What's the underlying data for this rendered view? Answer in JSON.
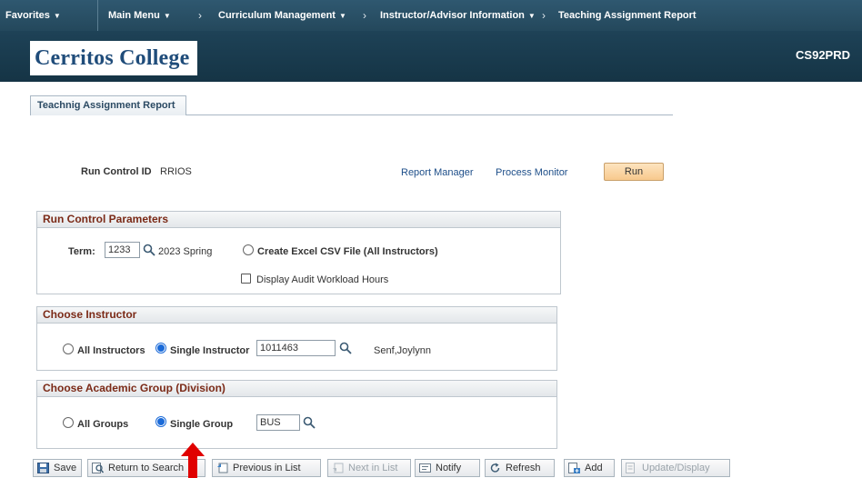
{
  "nav": {
    "favorites": "Favorites",
    "main_menu": "Main Menu",
    "crumbs": [
      "Curriculum Management",
      "Instructor/Advisor Information",
      "Teaching Assignment Report"
    ]
  },
  "header": {
    "logo": "Cerritos College",
    "database": "CS92PRD"
  },
  "page_tab": "Teachnig Assignment Report",
  "run_control": {
    "label": "Run Control ID",
    "value": "RRIOS",
    "report_manager": "Report Manager",
    "process_monitor": "Process Monitor",
    "run": "Run"
  },
  "params": {
    "title": "Run Control Parameters",
    "term_label": "Term:",
    "term_value": "1233",
    "term_desc": "2023 Spring",
    "excel_option": "Create Excel CSV File (All Instructors)",
    "audit_option": "Display Audit Workload Hours"
  },
  "instructor": {
    "title": "Choose Instructor",
    "all_label": "All Instructors",
    "single_label": "Single Instructor",
    "id_value": "1011463",
    "name": "Senf,Joylynn",
    "selected": "single"
  },
  "group": {
    "title": "Choose Academic Group (Division)",
    "all_label": "All Groups",
    "single_label": "Single Group",
    "value": "BUS",
    "selected": "single"
  },
  "toolbar": {
    "save": "Save",
    "return": "Return to Search",
    "previous": "Previous in List",
    "next": "Next in List",
    "notify": "Notify",
    "refresh": "Refresh",
    "add": "Add",
    "update": "Update/Display"
  },
  "colors": {
    "nav_bg": "#2f5870",
    "header_bg": "#1e4257",
    "section_title": "#7b2a17",
    "link": "#1d4e89",
    "run_button": "#f8c98d",
    "arrow": "#e00000"
  }
}
